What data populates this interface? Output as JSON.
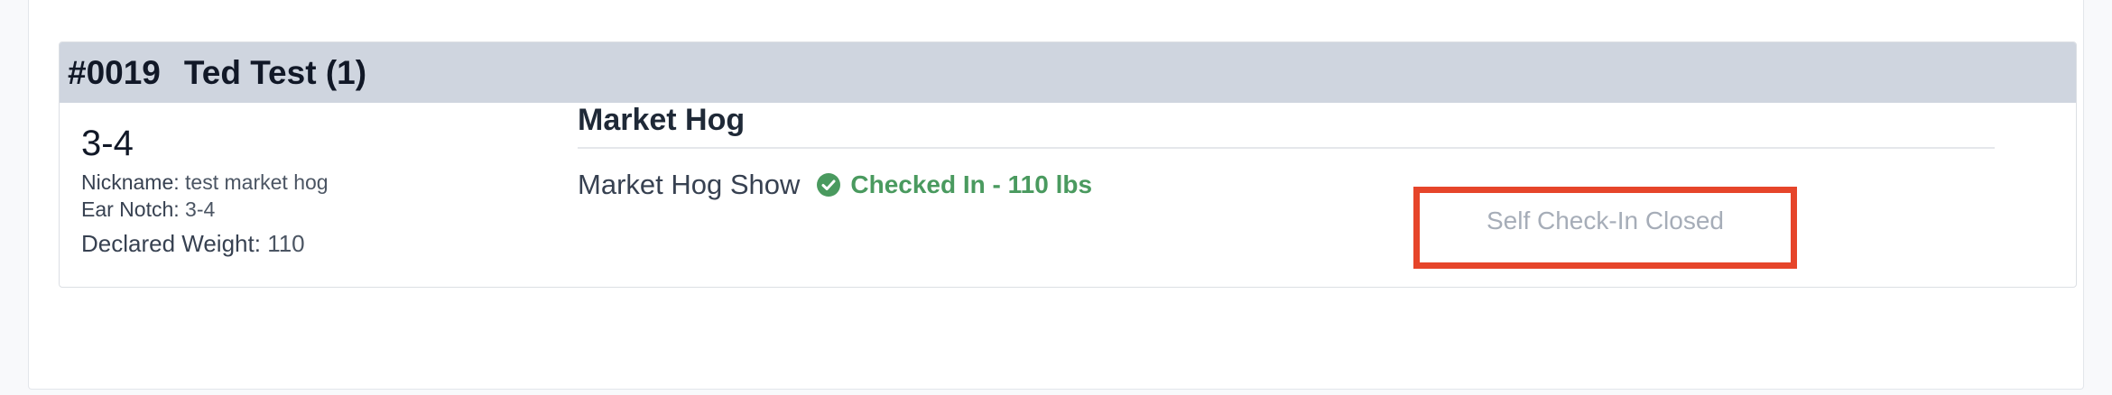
{
  "entry": {
    "number": "#0019",
    "exhibitor": "Ted Test (1)",
    "animal": {
      "tag": "3-4",
      "nickname_label": "Nickname:",
      "nickname": "test market hog",
      "ear_notch_label": "Ear Notch:",
      "ear_notch": "3-4",
      "weight_label": "Declared Weight:",
      "weight": "110"
    },
    "class": {
      "title": "Market Hog",
      "show_name": "Market Hog Show",
      "status_text": "Checked In - 110 lbs",
      "status_icon": "check-circle-icon",
      "status_color": "#4a9a5f"
    },
    "self_checkin": {
      "label": "Self Check-In Closed",
      "highlight_color": "#e6452a"
    }
  }
}
